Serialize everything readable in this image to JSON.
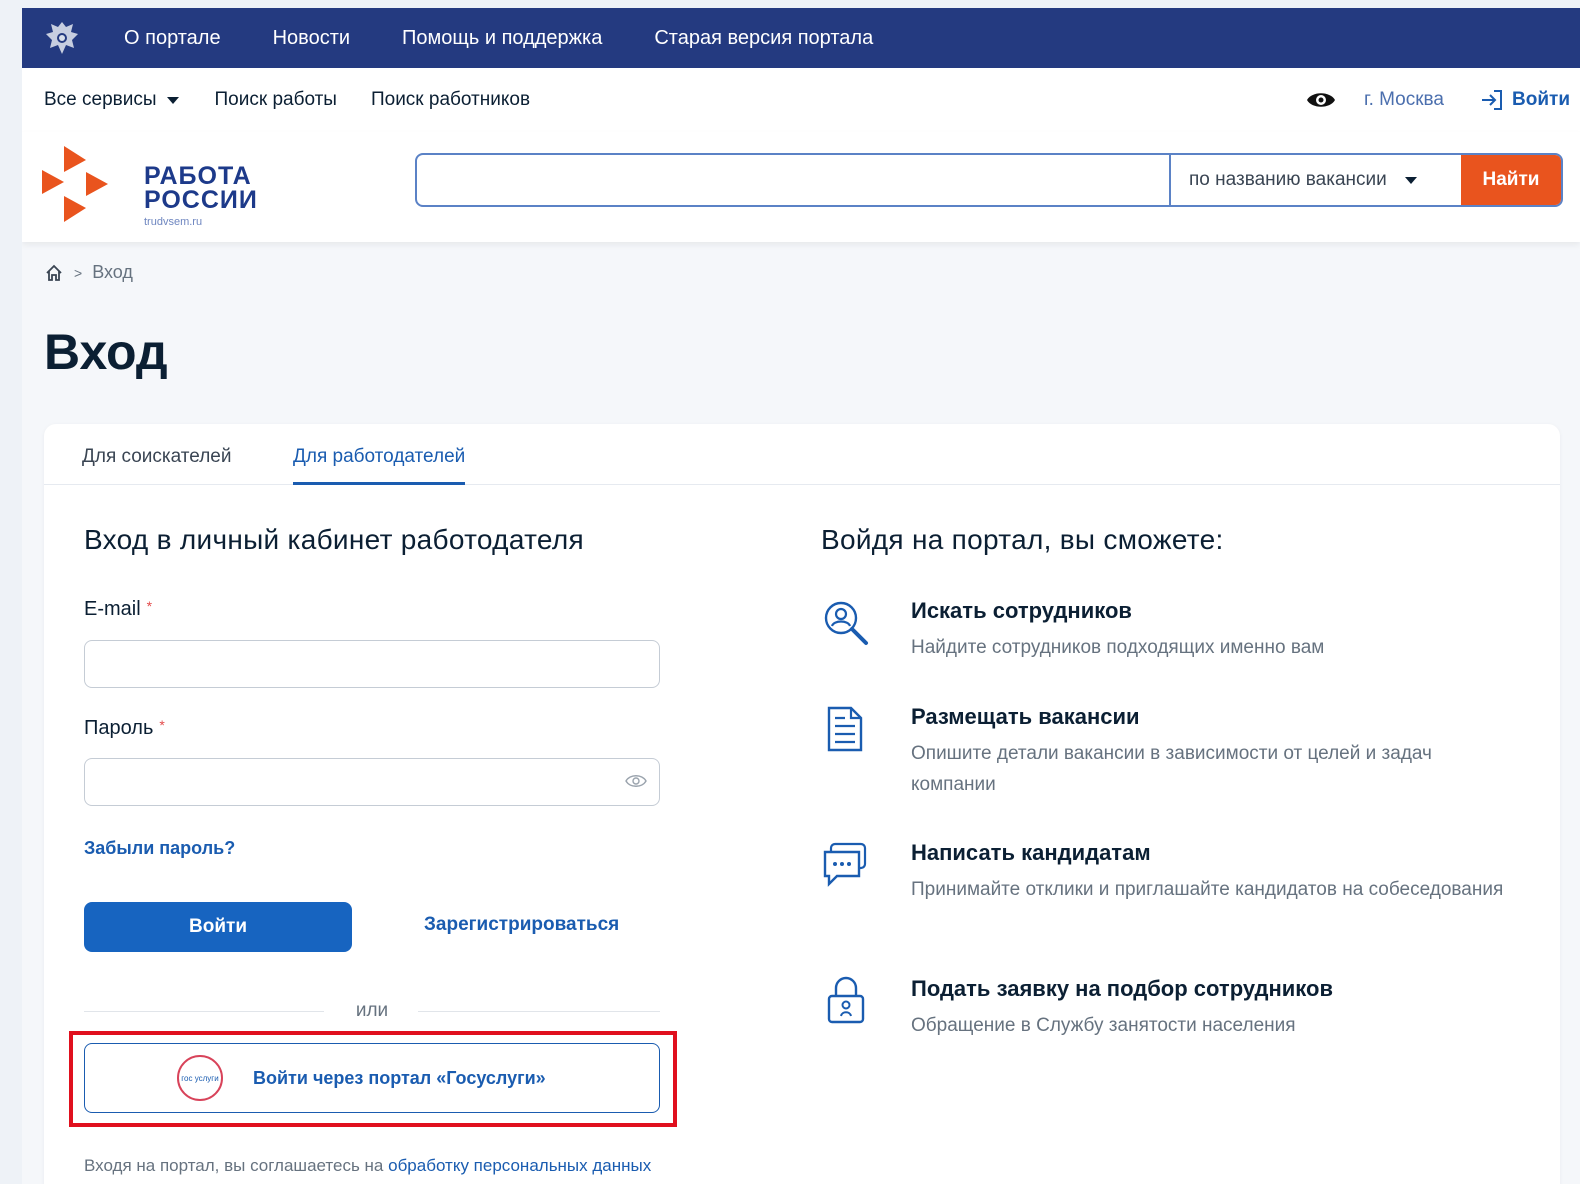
{
  "topbar": {
    "items": [
      "О портале",
      "Новости",
      "Помощь и поддержка",
      "Старая версия портала"
    ]
  },
  "subbar": {
    "all_services": "Все сервисы",
    "job_search": "Поиск работы",
    "worker_search": "Поиск работников",
    "city": "г. Москва",
    "login": "Войти"
  },
  "logo": {
    "line1": "РАБОТА",
    "line2": "РОССИИ",
    "sub": "trudvsem.ru"
  },
  "search": {
    "value": "",
    "mode": "по названию вакансии",
    "button": "Найти"
  },
  "breadcrumb": {
    "current": "Вход"
  },
  "page": {
    "title": "Вход"
  },
  "tabs": {
    "seekers": "Для соискателей",
    "employers": "Для работодателей"
  },
  "form": {
    "title": "Вход в личный кабинет работодателя",
    "email_label": "E-mail",
    "email_value": "",
    "password_label": "Пароль",
    "password_value": "",
    "required_mark": "*",
    "forgot": "Забыли пароль?",
    "login_button": "Войти",
    "register": "Зарегистрироваться",
    "or": "или",
    "gosuslugi_button": "Войти через портал «Госуслуги»",
    "gosuslugi_logo": "гос услуги",
    "consent_prefix": "Входя на портал, вы соглашаетесь на ",
    "consent_link": "обработку персональных данных"
  },
  "benefits": {
    "title": "Войдя на портал, вы сможете:",
    "items": [
      {
        "icon": "search-person-icon",
        "title": "Искать сотрудников",
        "desc": "Найдите сотрудников подходящих именно вам"
      },
      {
        "icon": "document-icon",
        "title": "Размещать вакансии",
        "desc": "Опишите детали вакансии в зависимости от целей и задач компании"
      },
      {
        "icon": "chat-icon",
        "title": "Написать кандидатам",
        "desc": "Принимайте отклики и приглашайте кандидатов на собеседования"
      },
      {
        "icon": "lock-icon",
        "title": "Подать заявку на подбор сотрудников",
        "desc": "Обращение в Службу занятости населения"
      }
    ]
  },
  "colors": {
    "topbar": "#243a80",
    "accent_blue": "#1764c0",
    "accent_orange": "#e9541e",
    "highlight": "#e0101e"
  }
}
